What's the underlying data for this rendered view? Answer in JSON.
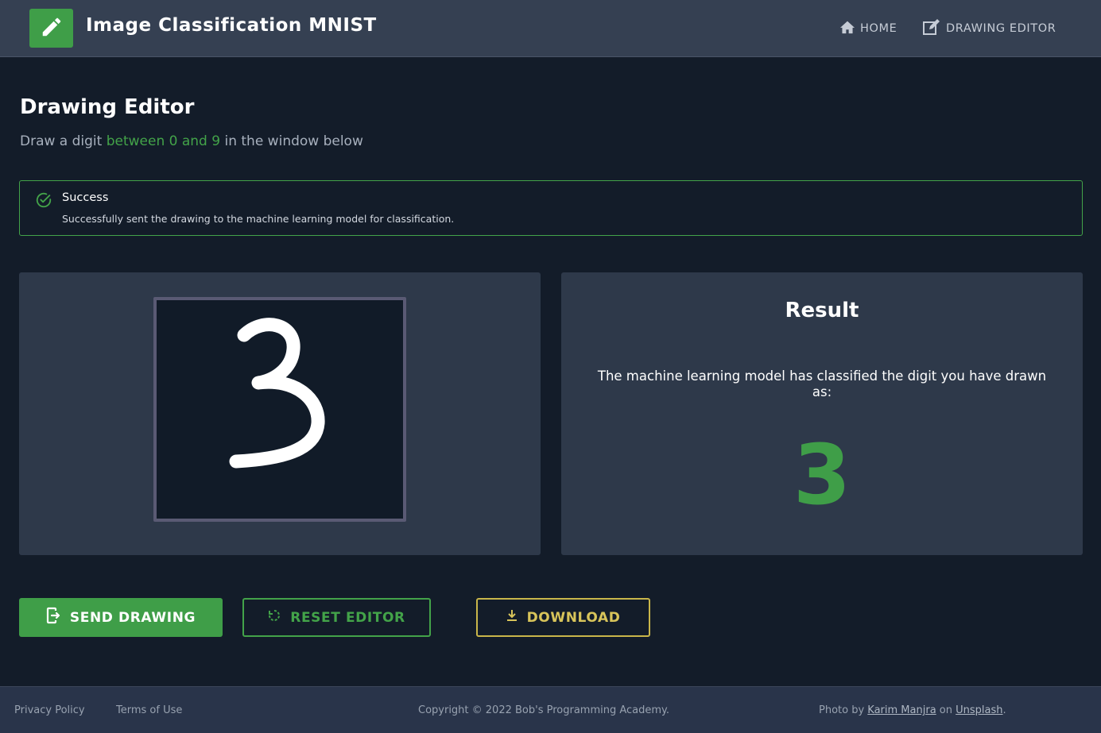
{
  "header": {
    "app_title": "Image Classification MNIST",
    "logo_icon": "pencil-icon",
    "nav": [
      {
        "label": "HOME",
        "icon": "home-icon"
      },
      {
        "label": "DRAWING EDITOR",
        "icon": "edit-icon"
      }
    ]
  },
  "page": {
    "title": "Drawing Editor",
    "subtitle_pre": "Draw a digit ",
    "subtitle_highlight": "between 0 and 9",
    "subtitle_post": " in the window below"
  },
  "alert": {
    "icon": "check-circle-icon",
    "title": "Success",
    "message": "Successfully sent the drawing to the machine learning model for classification."
  },
  "result": {
    "title": "Result",
    "text": "The machine learning model has classified the digit you have drawn as:",
    "digit": "3"
  },
  "buttons": {
    "send": "SEND DRAWING",
    "reset": "RESET EDITOR",
    "download": "DOWNLOAD"
  },
  "footer": {
    "privacy": "Privacy Policy",
    "terms": "Terms of Use",
    "copyright": "Copyright © 2022 Bob's Programming Academy.",
    "photo_pre": "Photo by ",
    "photo_author": "Karim Manjra",
    "photo_mid": " on ",
    "photo_site": "Unsplash",
    "photo_post": "."
  },
  "colors": {
    "accent": "#3f9e48",
    "download": "#c9b64a",
    "background": "#131c29",
    "panel": "#2e394a"
  }
}
